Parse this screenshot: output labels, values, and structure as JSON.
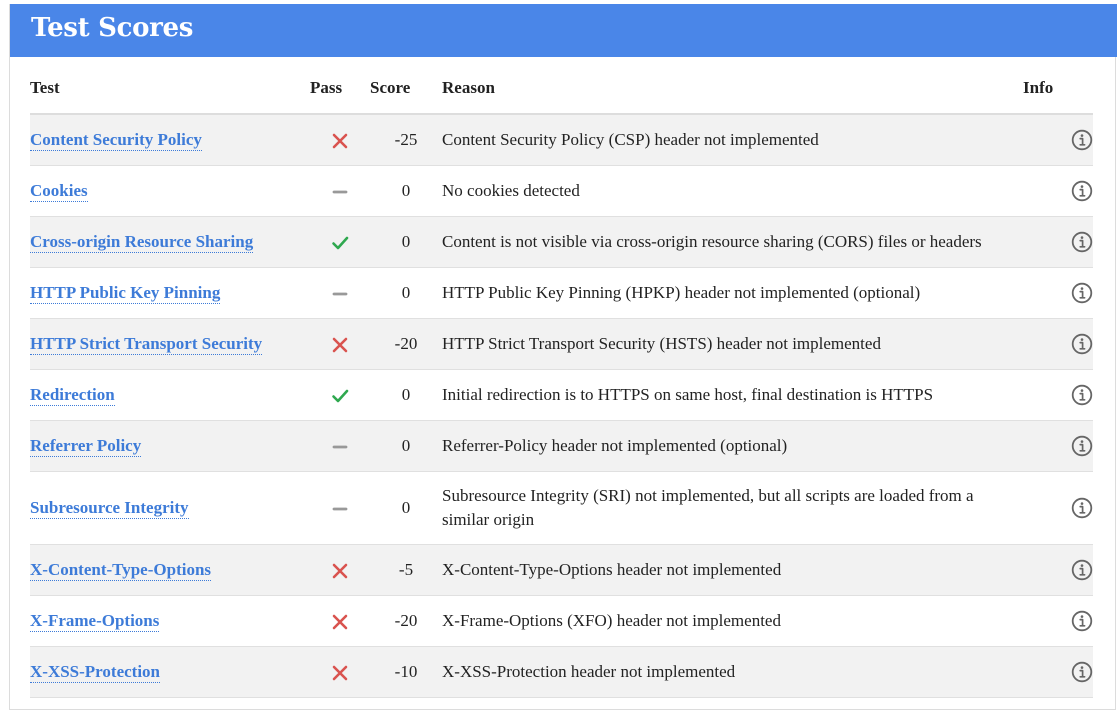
{
  "header": {
    "title": "Test Scores"
  },
  "columns": {
    "test": "Test",
    "pass": "Pass",
    "score": "Score",
    "reason": "Reason",
    "info": "Info"
  },
  "colors": {
    "header_bg": "#4a86e8",
    "link": "#3d7bd8",
    "fail": "#d9534f",
    "pass": "#2fa84f",
    "neutral": "#999999"
  },
  "rows": [
    {
      "test": "Content Security Policy",
      "pass": "fail",
      "pass_icon": "cross-icon",
      "score": "-25",
      "reason": "Content Security Policy (CSP) header not implemented"
    },
    {
      "test": "Cookies",
      "pass": "neutral",
      "pass_icon": "dash-icon",
      "score": "0",
      "reason": "No cookies detected"
    },
    {
      "test": "Cross-origin Resource Sharing",
      "pass": "pass",
      "pass_icon": "check-icon",
      "score": "0",
      "reason": "Content is not visible via cross-origin resource sharing (CORS) files or headers"
    },
    {
      "test": "HTTP Public Key Pinning",
      "pass": "neutral",
      "pass_icon": "dash-icon",
      "score": "0",
      "reason": "HTTP Public Key Pinning (HPKP) header not implemented (optional)"
    },
    {
      "test": "HTTP Strict Transport Security",
      "pass": "fail",
      "pass_icon": "cross-icon",
      "score": "-20",
      "reason": "HTTP Strict Transport Security (HSTS) header not implemented"
    },
    {
      "test": "Redirection",
      "pass": "pass",
      "pass_icon": "check-icon",
      "score": "0",
      "reason": "Initial redirection is to HTTPS on same host, final destination is HTTPS"
    },
    {
      "test": "Referrer Policy",
      "pass": "neutral",
      "pass_icon": "dash-icon",
      "score": "0",
      "reason": "Referrer-Policy header not implemented (optional)"
    },
    {
      "test": "Subresource Integrity",
      "pass": "neutral",
      "pass_icon": "dash-icon",
      "score": "0",
      "reason": "Subresource Integrity (SRI) not implemented, but all scripts are loaded from a similar origin"
    },
    {
      "test": "X-Content-Type-Options",
      "pass": "fail",
      "pass_icon": "cross-icon",
      "score": "-5",
      "reason": "X-Content-Type-Options header not implemented"
    },
    {
      "test": "X-Frame-Options",
      "pass": "fail",
      "pass_icon": "cross-icon",
      "score": "-20",
      "reason": "X-Frame-Options (XFO) header not implemented"
    },
    {
      "test": "X-XSS-Protection",
      "pass": "fail",
      "pass_icon": "cross-icon",
      "score": "-10",
      "reason": "X-XSS-Protection header not implemented"
    }
  ],
  "info_icon": "info-circle-icon"
}
